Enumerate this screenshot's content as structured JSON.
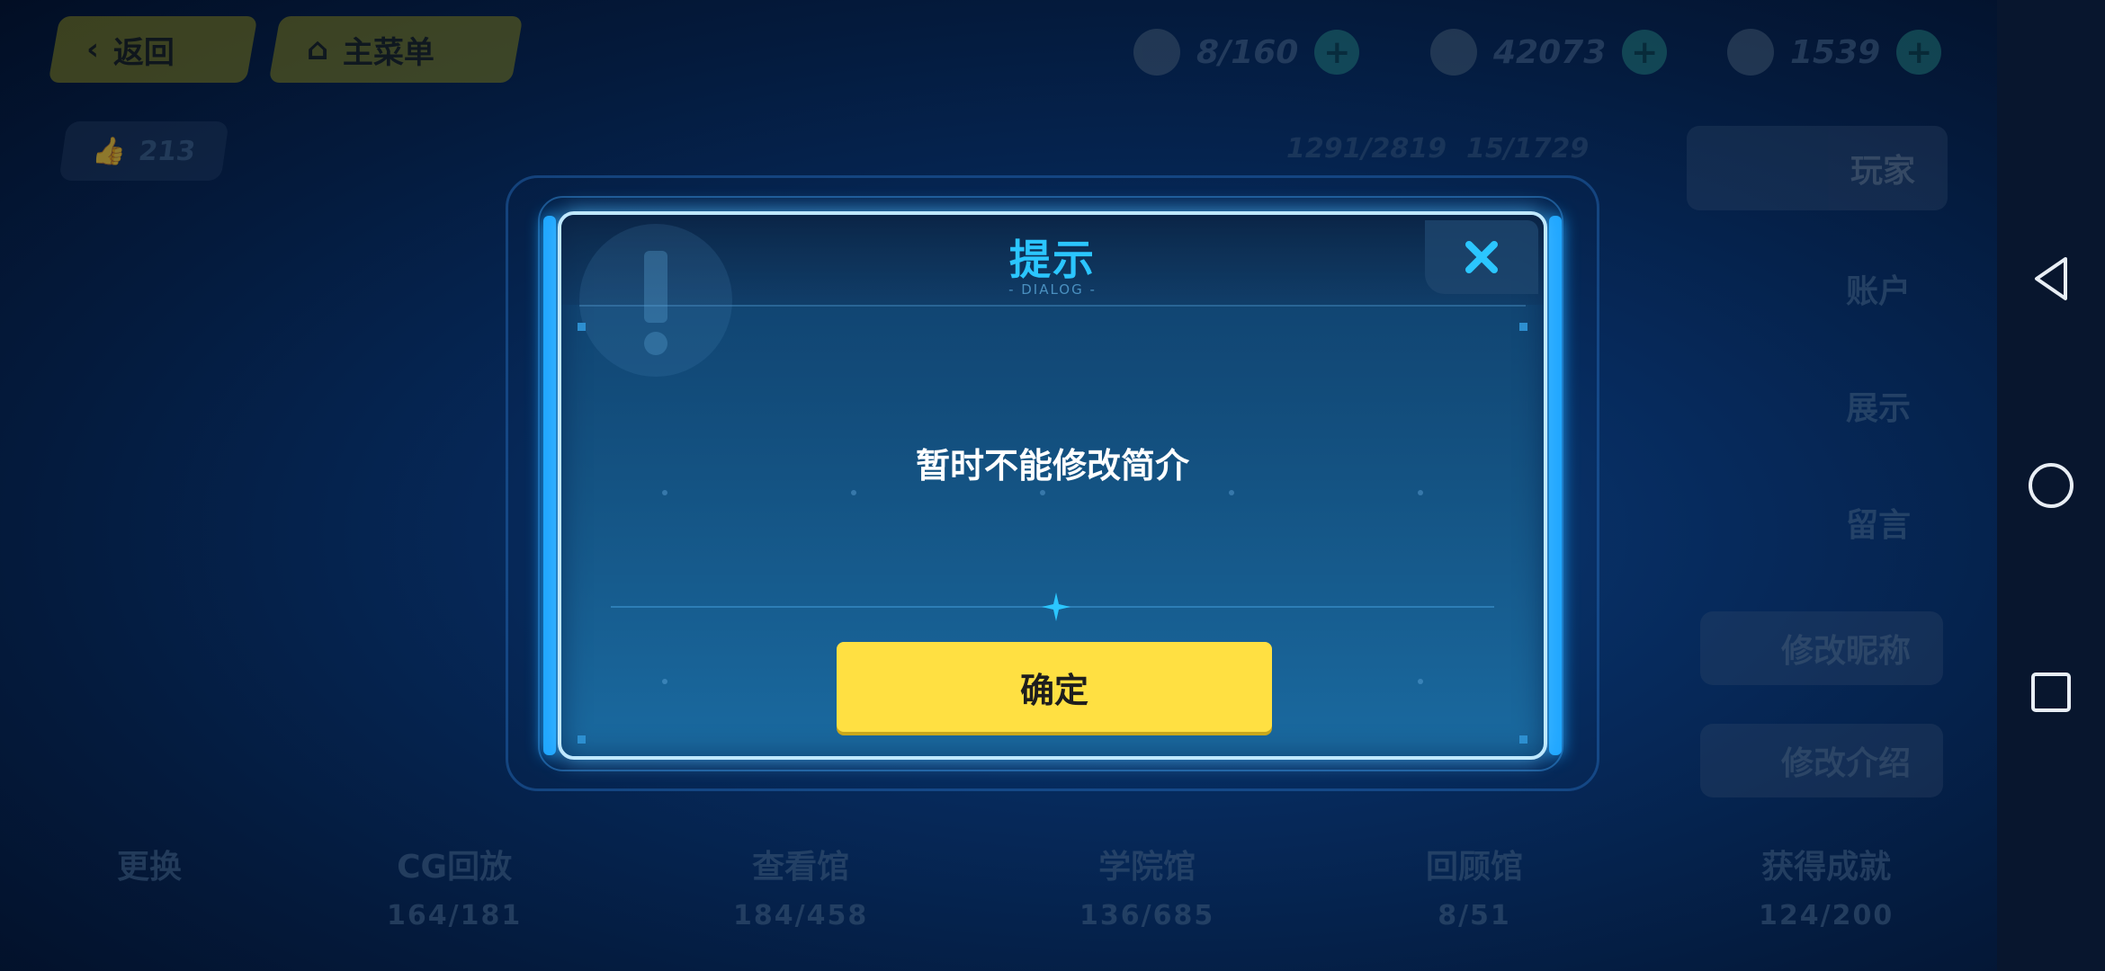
{
  "background": {
    "back_label": "返回",
    "main_menu_label": "主菜单",
    "likes": "213",
    "progress_a": "1291/2819",
    "progress_b": "15/1729",
    "resources": [
      {
        "value": "8/160"
      },
      {
        "value": "42073"
      },
      {
        "value": "1539"
      }
    ],
    "side_tabs": [
      "玩家",
      "账户",
      "展示",
      "留言"
    ],
    "side_actions": [
      "修改昵称",
      "修改介绍"
    ],
    "stats": [
      {
        "label": "更换",
        "value": ""
      },
      {
        "label": "CG回放",
        "value": "164/181"
      },
      {
        "label": "查看馆",
        "value": "184/458"
      },
      {
        "label": "学院馆",
        "value": "136/685"
      },
      {
        "label": "回顾馆",
        "value": "8/51"
      },
      {
        "label": "获得成就",
        "value": "124/200"
      }
    ]
  },
  "dialog": {
    "title": "提示",
    "subtitle": "- DIALOG -",
    "message": "暂时不能修改简介",
    "confirm_label": "确定",
    "close_icon": "close-icon"
  },
  "navbar": {
    "icons": [
      "back-triangle-icon",
      "home-circle-icon",
      "recent-square-icon"
    ]
  },
  "colors": {
    "accent": "#2bc6ff",
    "button": "#ffe042",
    "dialog_border": "#bfe8ff"
  }
}
